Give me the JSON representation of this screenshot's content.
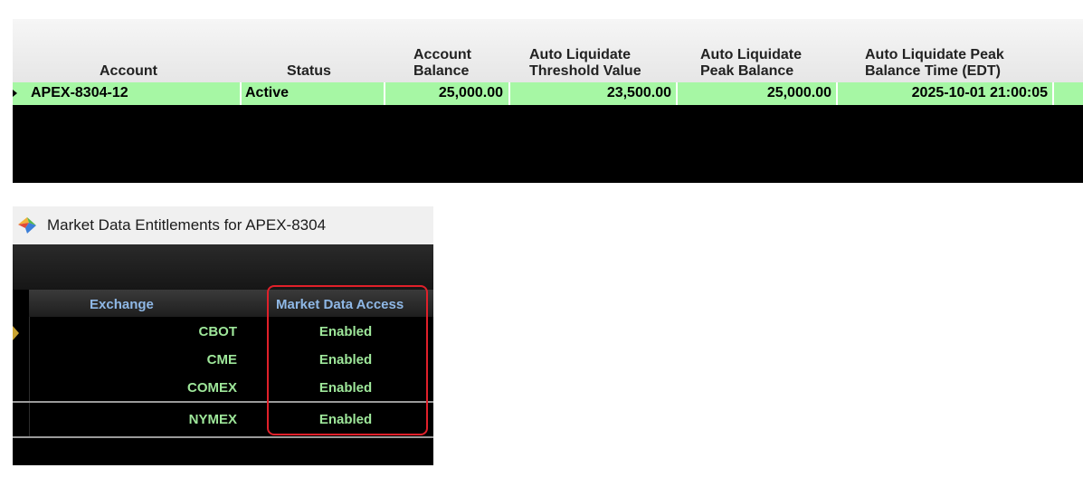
{
  "account_grid": {
    "headers": [
      "Account",
      "Status",
      "Account\nBalance",
      "Auto Liquidate\nThreshold Value",
      "Auto Liquidate\nPeak Balance",
      "Auto Liquidate Peak\nBalance Time (EDT)"
    ],
    "row": {
      "account": "APEX-8304-12",
      "status": "Active",
      "account_balance": "25,000.00",
      "threshold_value": "23,500.00",
      "peak_balance": "25,000.00",
      "peak_balance_time": "2025-10-01 21:00:05"
    },
    "row_color": "#a6f7a4"
  },
  "market_data_window": {
    "title": "Market Data Entitlements for APEX-8304",
    "columns": {
      "exchange": "Exchange",
      "access": "Market Data Access"
    },
    "rows": [
      {
        "exchange": "CBOT",
        "access": "Enabled"
      },
      {
        "exchange": "CME",
        "access": "Enabled"
      },
      {
        "exchange": "COMEX",
        "access": "Enabled"
      },
      {
        "exchange": "NYMEX",
        "access": "Enabled"
      }
    ],
    "highlight_color": "#e0202a",
    "value_color": "#9ee79a",
    "header_color": "#8fb8e6"
  }
}
